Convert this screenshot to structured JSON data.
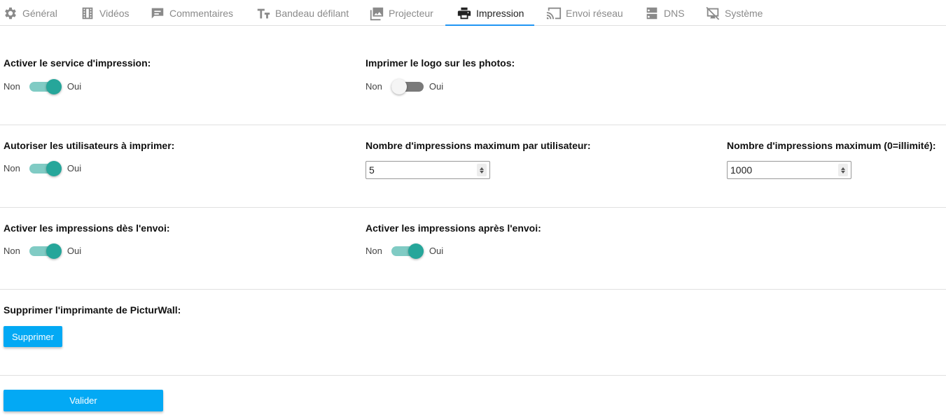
{
  "tabs": [
    {
      "label": "Général",
      "icon": "gear-icon",
      "active": false
    },
    {
      "label": "Vidéos",
      "icon": "film-icon",
      "active": false
    },
    {
      "label": "Commentaires",
      "icon": "comment-icon",
      "active": false
    },
    {
      "label": "Bandeau défilant",
      "icon": "text-size-icon",
      "active": false
    },
    {
      "label": "Projecteur",
      "icon": "photo-library-icon",
      "active": false
    },
    {
      "label": "Impression",
      "icon": "printer-icon",
      "active": true
    },
    {
      "label": "Envoi réseau",
      "icon": "cast-icon",
      "active": false
    },
    {
      "label": "DNS",
      "icon": "dns-icon",
      "active": false
    },
    {
      "label": "Système",
      "icon": "system-icon",
      "active": false
    }
  ],
  "accent_color": "#2196f3",
  "toggle_on_color": "#26a69a",
  "button_color": "#03a9f4",
  "settings": {
    "print_service": {
      "label": "Activer le service d'impression:",
      "off": "Non",
      "on": "Oui",
      "checked": true
    },
    "print_logo": {
      "label": "Imprimer le logo sur les photos:",
      "off": "Non",
      "on": "Oui",
      "checked": false
    },
    "allow_users": {
      "label": "Autoriser les utilisateurs à imprimer:",
      "off": "Non",
      "on": "Oui",
      "checked": true
    },
    "max_per_user": {
      "label": "Nombre d'impressions maximum par utilisateur:",
      "value": "5"
    },
    "max_total": {
      "label": "Nombre d'impressions maximum (0=illimité):",
      "value": "1000"
    },
    "print_on_send": {
      "label": "Activer les impressions dès l'envoi:",
      "off": "Non",
      "on": "Oui",
      "checked": true
    },
    "print_after_send": {
      "label": "Activer les impressions après l'envoi:",
      "off": "Non",
      "on": "Oui",
      "checked": true
    },
    "remove_printer": {
      "label": "Supprimer l'imprimante de PicturWall:",
      "button": "Supprimer"
    }
  },
  "submit_label": "Valider"
}
